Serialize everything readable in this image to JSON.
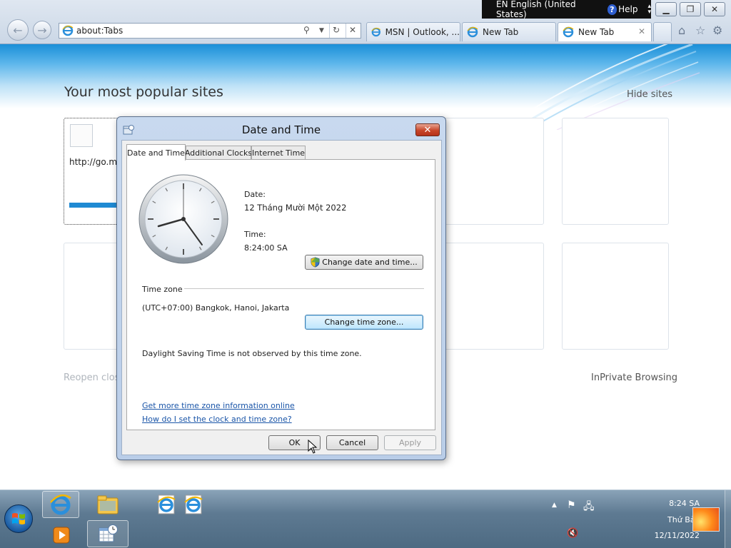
{
  "system": {
    "language_label": "EN English (United States)",
    "help_label": "Help"
  },
  "ie": {
    "address_url": "about:Tabs",
    "tabs": [
      {
        "label": "MSN | Outlook, ...",
        "active": false
      },
      {
        "label": "New Tab",
        "active": false
      },
      {
        "label": "New Tab",
        "active": true
      }
    ]
  },
  "page": {
    "popular_title": "Your most popular sites",
    "hide_sites": "Hide sites",
    "first_tile_url": "http://go.m",
    "reopen_label": "Reopen clos",
    "inprivate_label": "InPrivate Browsing"
  },
  "dialog": {
    "title": "Date and Time",
    "tabs": [
      "Date and Time",
      "Additional Clocks",
      "Internet Time"
    ],
    "date_label": "Date:",
    "date_value": "12 Tháng Mười Một 2022",
    "time_label": "Time:",
    "time_value": "8:24:00 SA",
    "change_datetime_button": "Change date and time...",
    "timezone_heading": "Time zone",
    "timezone_value": "(UTC+07:00) Bangkok, Hanoi, Jakarta",
    "change_timezone_button": "Change time zone...",
    "dst_note": "Daylight Saving Time is not observed by this time zone.",
    "link_more_info": "Get more time zone information online",
    "link_how_to": "How do I set the clock and time zone?",
    "ok_button": "OK",
    "cancel_button": "Cancel",
    "apply_button": "Apply"
  },
  "taskbar": {
    "clock_time": "8:24 SA",
    "clock_day": "Thứ Bảy",
    "clock_date": "12/11/2022"
  },
  "colors": {
    "ie_blue": "#1f8ad3",
    "link_blue": "#1a55a8",
    "close_red": "#c8462a"
  }
}
